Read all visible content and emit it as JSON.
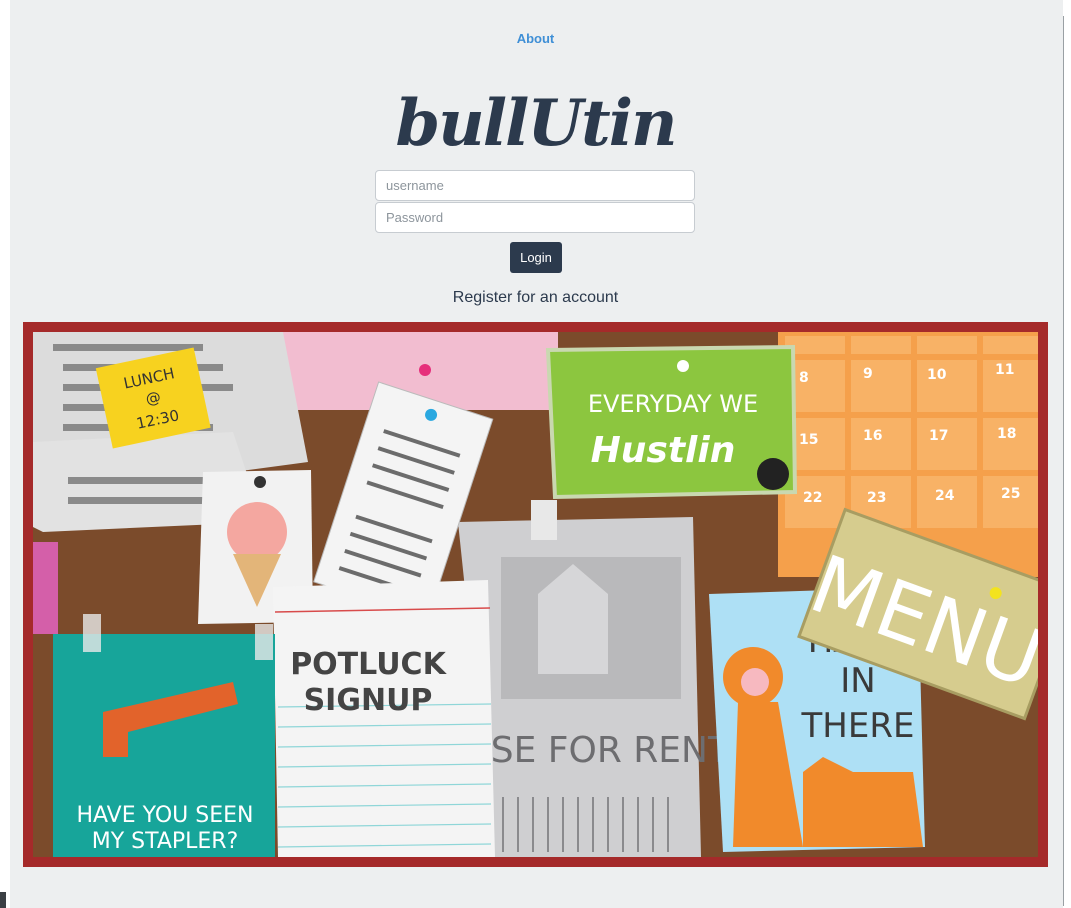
{
  "nav": {
    "about_label": "About"
  },
  "brand": {
    "logo_text": "bullUtin"
  },
  "login_form": {
    "username_placeholder": "username",
    "password_placeholder": "Password",
    "login_label": "Login"
  },
  "register_link": "Register for an account",
  "colors": {
    "frame": "#a52a2a",
    "cork": "#7a4a2a",
    "brand": "#2c3a4d",
    "link": "#3f8fd6"
  },
  "board": {
    "lunch_note": [
      "LUNCH",
      "@",
      "12:30"
    ],
    "hustle_card": {
      "line1": "EVERYDAY WE",
      "line2": "Hustlin"
    },
    "calendar_numbers": [
      "8",
      "9",
      "10",
      "11",
      "15",
      "16",
      "17",
      "18",
      "22",
      "23",
      "24",
      "25"
    ],
    "menu_sign": "MENU",
    "potluck": [
      "POTLUCK",
      "SIGNUP"
    ],
    "house": "OUSE FOR RENT",
    "stapler": [
      "HAVE YOU SEEN",
      "MY STAPLER?"
    ],
    "hang": [
      "HANG",
      "IN",
      "THERE"
    ]
  }
}
